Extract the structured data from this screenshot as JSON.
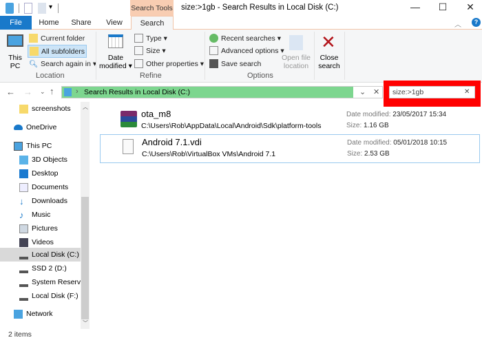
{
  "window": {
    "title": "size:>1gb - Search Results in Local Disk (C:)",
    "minimize": "—",
    "maximize": "☐",
    "close": "✕"
  },
  "tabs": {
    "file": "File",
    "home": "Home",
    "share": "Share",
    "view": "View",
    "search_tools": "Search Tools",
    "search": "Search"
  },
  "ribbon": {
    "location": {
      "label": "Location",
      "this_pc": "This PC",
      "current_folder": "Current folder",
      "all_subfolders": "All subfolders",
      "search_again": "Search again in ▾"
    },
    "refine": {
      "label": "Refine",
      "date_modified": "Date modified ▾",
      "type": "Type ▾",
      "size": "Size ▾",
      "other": "Other properties ▾"
    },
    "options": {
      "label": "Options",
      "recent": "Recent searches ▾",
      "advanced": "Advanced options ▾",
      "save": "Save search",
      "open_location": "Open file location"
    },
    "close_search": "Close search"
  },
  "address": {
    "path": "Search Results in Local Disk (C:)",
    "chevron": "›"
  },
  "search": {
    "value": "size:>1gb",
    "clear": "✕"
  },
  "nav": {
    "items": [
      {
        "label": "screenshots",
        "icon": "folder-icon"
      },
      {
        "label": "OneDrive",
        "icon": "cloud-icon"
      },
      {
        "label": "This PC",
        "icon": "computer-icon"
      },
      {
        "label": "3D Objects",
        "icon": "cube-icon"
      },
      {
        "label": "Desktop",
        "icon": "desktop-icon"
      },
      {
        "label": "Documents",
        "icon": "document-icon"
      },
      {
        "label": "Downloads",
        "icon": "download-icon"
      },
      {
        "label": "Music",
        "icon": "music-icon"
      },
      {
        "label": "Pictures",
        "icon": "pictures-icon"
      },
      {
        "label": "Videos",
        "icon": "video-icon"
      },
      {
        "label": "Local Disk (C:)",
        "icon": "drive-icon"
      },
      {
        "label": "SSD 2 (D:)",
        "icon": "drive-icon"
      },
      {
        "label": "System Reserved",
        "icon": "drive-icon"
      },
      {
        "label": "Local Disk (F:)",
        "icon": "drive-icon"
      },
      {
        "label": "Network",
        "icon": "network-icon"
      }
    ]
  },
  "results": [
    {
      "name": "ota_m8",
      "path": "C:\\Users\\Rob\\AppData\\Local\\Android\\Sdk\\platform-tools",
      "date_label": "Date modified:",
      "date": "23/05/2017 15:34",
      "size_label": "Size:",
      "size": "1.16 GB"
    },
    {
      "name": "Android 7.1.vdi",
      "path": "C:\\Users\\Rob\\VirtualBox VMs\\Android 7.1",
      "date_label": "Date modified:",
      "date": "05/01/2018 10:15",
      "size_label": "Size:",
      "size": "2.53 GB"
    }
  ],
  "status": {
    "items": "2 items"
  },
  "colors": {
    "accent": "#1979ca",
    "highlight": "#ff0000",
    "address_bg": "#7dd68f",
    "search_tools": "#f8cdb2"
  }
}
